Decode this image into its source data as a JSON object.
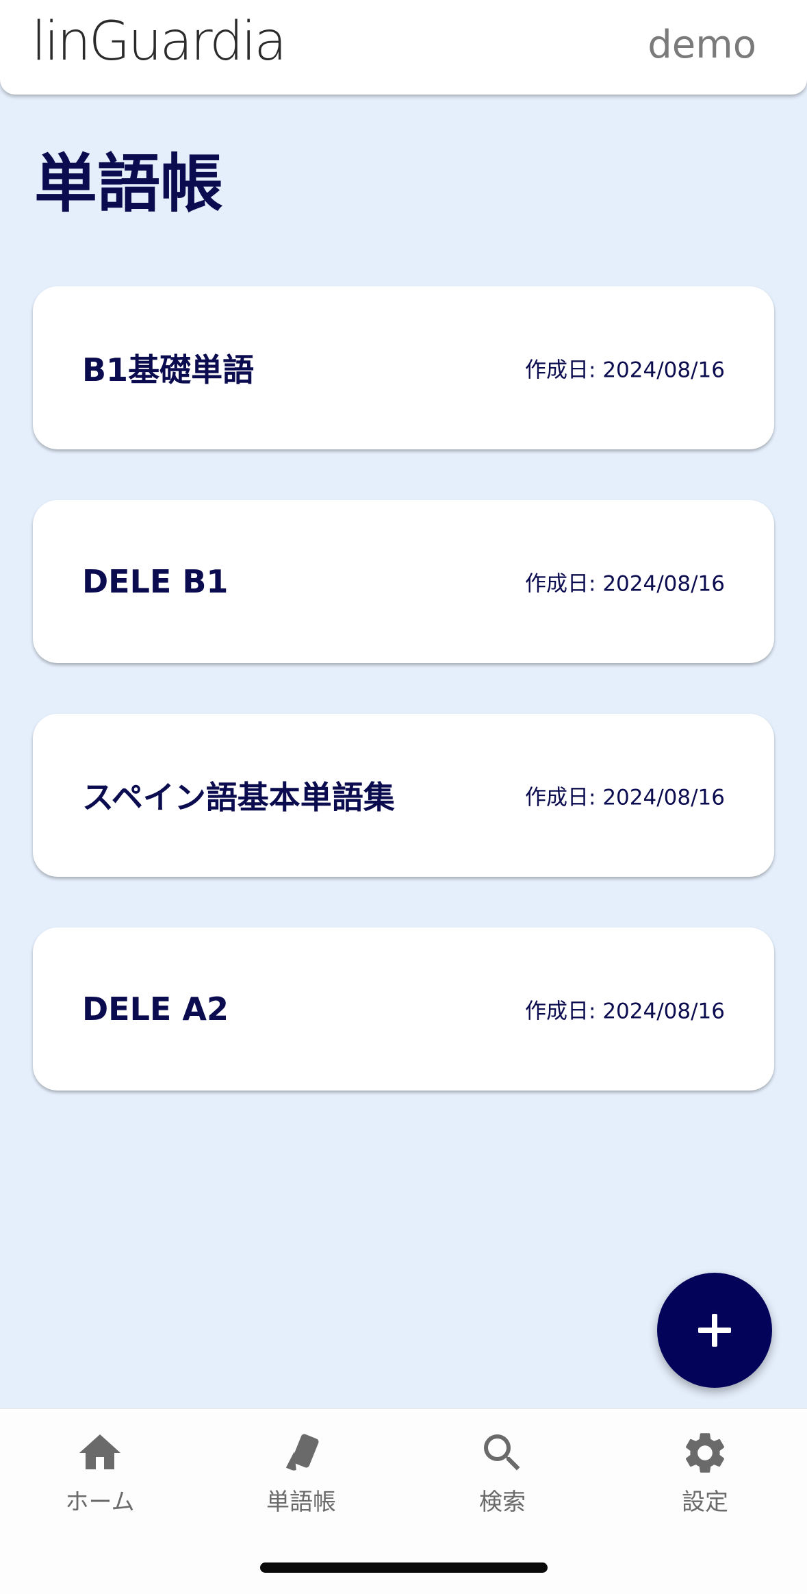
{
  "header": {
    "logo_text": "linGuardia",
    "user_name": "demo"
  },
  "page": {
    "title": "単語帳"
  },
  "decks": [
    {
      "name": "B1基礎単語",
      "date": "作成日: 2024/08/16"
    },
    {
      "name": "DELE B1",
      "date": "作成日: 2024/08/16"
    },
    {
      "name": "スペイン語基本単語集",
      "date": "作成日: 2024/08/16"
    },
    {
      "name": "DELE A2",
      "date": "作成日: 2024/08/16"
    }
  ],
  "fab": {
    "icon": "plus-icon"
  },
  "bottom_nav": {
    "items": [
      {
        "label": "ホーム",
        "icon": "home-icon"
      },
      {
        "label": "単語帳",
        "icon": "cards-icon"
      },
      {
        "label": "検索",
        "icon": "search-icon"
      },
      {
        "label": "設定",
        "icon": "gear-icon"
      }
    ]
  },
  "colors": {
    "background": "#e5effc",
    "primary_dark": "#0b0b4f",
    "fab": "#03035a",
    "nav_inactive": "#6a6a6a"
  }
}
